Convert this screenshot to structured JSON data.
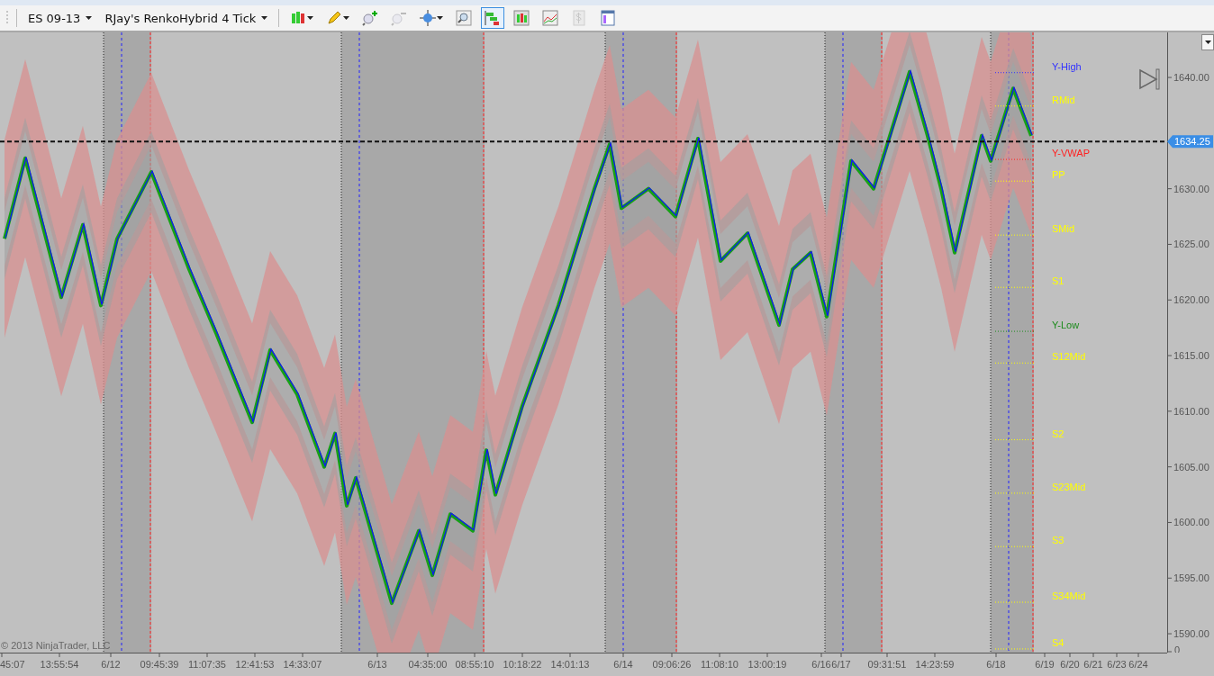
{
  "toolbar": {
    "instrument": "ES 09-13",
    "bar_type": "RJay's RenkoHybrid  4 Tick",
    "tools": [
      {
        "kind": "candles",
        "selected": false,
        "disabled": false,
        "menu": true
      },
      {
        "kind": "pencil",
        "selected": false,
        "disabled": false,
        "menu": true
      },
      {
        "kind": "zoom-in",
        "selected": false,
        "disabled": false,
        "menu": false
      },
      {
        "kind": "zoom-out",
        "selected": false,
        "disabled": true,
        "menu": false
      },
      {
        "kind": "crosshair",
        "selected": false,
        "disabled": false,
        "menu": true
      },
      {
        "kind": "magnifier",
        "selected": false,
        "disabled": false,
        "menu": false
      },
      {
        "kind": "panels",
        "selected": true,
        "disabled": false,
        "menu": false
      },
      {
        "kind": "bars",
        "selected": false,
        "disabled": false,
        "menu": false
      },
      {
        "kind": "line",
        "selected": false,
        "disabled": false,
        "menu": false
      },
      {
        "kind": "dollar",
        "selected": false,
        "disabled": true,
        "menu": false
      },
      {
        "kind": "databox",
        "selected": false,
        "disabled": false,
        "menu": false
      }
    ]
  },
  "chart": {
    "copyright": "© 2013 NinjaTrader, LLC",
    "last_price": "1634.25",
    "volume_zero_label": "0",
    "price_labels": [
      "1640.00",
      "1630.00",
      "1625.00",
      "1620.00",
      "1615.00",
      "1610.00",
      "1605.00",
      "1600.00",
      "1595.00",
      "1590.00"
    ],
    "time_labels": [
      "45:07",
      "13:55:54",
      "6/12",
      "09:45:39",
      "11:07:35",
      "12:41:53",
      "14:33:07",
      "6/13",
      "04:35:00",
      "08:55:10",
      "10:18:22",
      "14:01:13",
      "6/14",
      "09:06:26",
      "11:08:10",
      "13:00:19",
      "6/16",
      "6/17",
      "09:31:51",
      "14:23:59",
      "6/18",
      "6/19",
      "6/20",
      "6/21",
      "6/23",
      "6/24"
    ],
    "levels": [
      {
        "label": "Y-High",
        "color": "#3232ff"
      },
      {
        "label": "RMid",
        "color": "#ffff00"
      },
      {
        "label": "Y-VWAP",
        "color": "#ff2020"
      },
      {
        "label": "PP",
        "color": "#ffff00"
      },
      {
        "label": "SMid",
        "color": "#ffff00"
      },
      {
        "label": "S1",
        "color": "#ffff00"
      },
      {
        "label": "Y-Low",
        "color": "#1a8a1a"
      },
      {
        "label": "S12Mid",
        "color": "#ffff00"
      },
      {
        "label": "S2",
        "color": "#ffff00"
      },
      {
        "label": "S23Mid",
        "color": "#ffff00"
      },
      {
        "label": "S3",
        "color": "#ffff00"
      },
      {
        "label": "S34Mid",
        "color": "#ffff00"
      },
      {
        "label": "S4",
        "color": "#ffff00"
      }
    ]
  }
}
